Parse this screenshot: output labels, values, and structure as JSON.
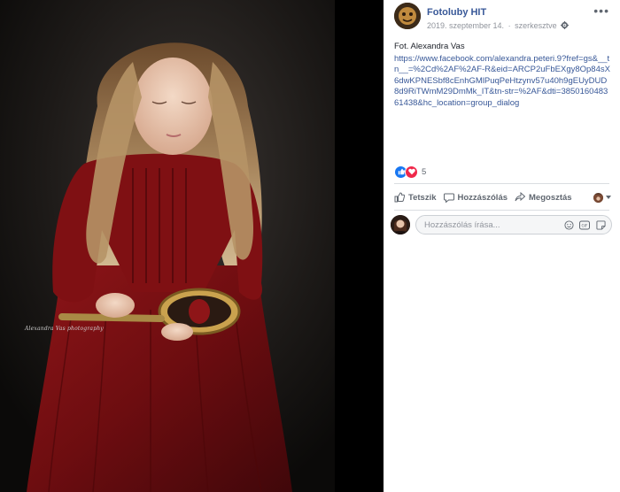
{
  "post": {
    "page_name": "Fotoluby HIT",
    "date": "2019. szeptember 14.",
    "separator": "·",
    "edited": "szerkesztve",
    "more": "•••",
    "caption": "Fot. Alexandra Vas",
    "link": "https://www.facebook.com/alexandra.peteri.9?fref=gs&__tn__=%2Cd%2AF%2AF-R&eid=ARCP2uFbEXgy8Op84sX6dwKPNESbf8cEnhGMlPuqPeHtzynv57u40h9gEUyDUD8d9RiTWmM29DmMk_IT&tn-str=%2AF&dti=385016048361438&hc_location=group_dialog",
    "reaction_count": "5"
  },
  "actions": {
    "like": "Tetszik",
    "comment": "Hozzászólás",
    "share": "Megosztás"
  },
  "comment": {
    "placeholder": "Hozzászólás írása..."
  },
  "photo": {
    "watermark": "Alexandra Vas photography"
  },
  "colors": {
    "link": "#385898",
    "like_blue": "#1877f2",
    "love_red": "#f0284a",
    "dress_red": "#7a0f12"
  },
  "icons": [
    "gear-icon",
    "more-icon",
    "like-reaction-icon",
    "love-reaction-icon",
    "thumb-up-icon",
    "comment-bubble-icon",
    "share-arrow-icon",
    "caret-down-icon",
    "emoji-icon",
    "gif-icon",
    "sticker-icon"
  ]
}
